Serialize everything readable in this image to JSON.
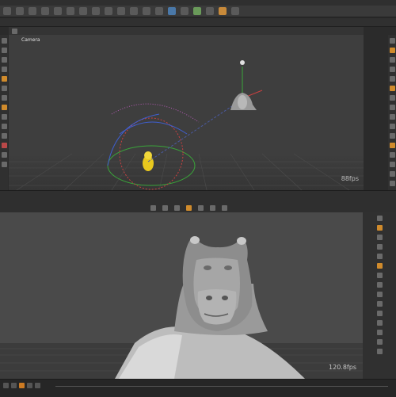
{
  "colors": {
    "accent": "#d08b2c",
    "viewport_bg": "#3e3e3e",
    "render_bg": "#4a4a4a",
    "highlight_model": "#e8c81e"
  },
  "viewport_top": {
    "camera_label": "Camera",
    "fps": "88fps"
  },
  "viewport_bottom": {
    "fps": "120.8fps"
  },
  "icons": [
    "home-icon",
    "camera-icon",
    "light-icon",
    "gear-icon",
    "grid-icon",
    "magnet-icon",
    "play-icon",
    "stop-icon",
    "prev-frame-icon",
    "next-frame-icon"
  ]
}
